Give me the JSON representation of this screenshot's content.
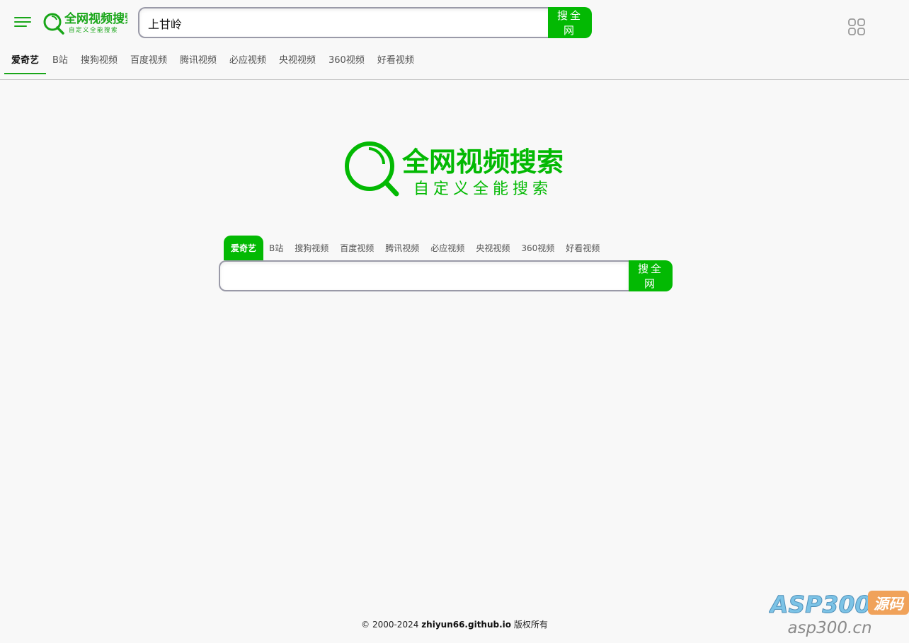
{
  "header": {
    "logo": {
      "title": "全网视频搜索",
      "subtitle": "自定义全能搜索"
    },
    "search": {
      "value": "上甘岭",
      "placeholder": "",
      "button_label": "搜全网"
    },
    "tabs": [
      {
        "label": "爱奇艺",
        "active": true
      },
      {
        "label": "B站",
        "active": false
      },
      {
        "label": "搜狗视频",
        "active": false
      },
      {
        "label": "百度视频",
        "active": false
      },
      {
        "label": "腾讯视频",
        "active": false
      },
      {
        "label": "必应视频",
        "active": false
      },
      {
        "label": "央视视频",
        "active": false
      },
      {
        "label": "360视频",
        "active": false
      },
      {
        "label": "好看视频",
        "active": false
      }
    ],
    "icons": [
      "menu-icon",
      "apps-grid-icon"
    ]
  },
  "main": {
    "logo": {
      "title": "全网视频搜索",
      "subtitle": "自定义全能搜索"
    },
    "tabs": [
      {
        "label": "爱奇艺",
        "active": true
      },
      {
        "label": "B站",
        "active": false
      },
      {
        "label": "搜狗视频",
        "active": false
      },
      {
        "label": "百度视频",
        "active": false
      },
      {
        "label": "腾讯视频",
        "active": false
      },
      {
        "label": "必应视频",
        "active": false
      },
      {
        "label": "央视视频",
        "active": false
      },
      {
        "label": "360视频",
        "active": false
      },
      {
        "label": "好看视频",
        "active": false
      }
    ],
    "search": {
      "value": "",
      "button_label": "搜全网"
    }
  },
  "footer": {
    "copyright_prefix": "© 2000-2024",
    "site": "zhiyun66.github.io",
    "suffix": "版权所有"
  },
  "watermark": {
    "brand": "ASP300",
    "tag": "源码",
    "domain": "asp300.cn"
  },
  "colors": {
    "accent": "#03b903",
    "logo_green": "#19a619",
    "background": "#f8f8f8",
    "input_border": "#9a9aa8",
    "watermark_blue": "#6fb4d8",
    "watermark_orange": "#f0a25a"
  }
}
